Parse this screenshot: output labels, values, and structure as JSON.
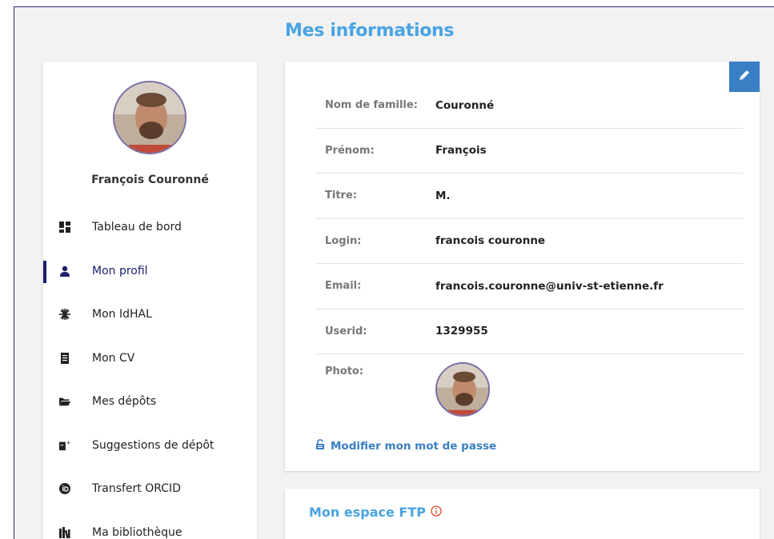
{
  "page": {
    "title": "Mes informations"
  },
  "sidebar": {
    "user_name": "François Couronné",
    "items": [
      {
        "label": "Tableau de bord",
        "icon": "dashboard-icon",
        "active": false
      },
      {
        "label": "Mon profil",
        "icon": "user-icon",
        "active": true
      },
      {
        "label": "Mon IdHAL",
        "icon": "idhal-icon",
        "active": false
      },
      {
        "label": "Mon CV",
        "icon": "cv-icon",
        "active": false
      },
      {
        "label": "Mes dépôts",
        "icon": "folder-icon",
        "active": false
      },
      {
        "label": "Suggestions de dépôt",
        "icon": "suggestion-icon",
        "active": false
      },
      {
        "label": "Transfert ORCID",
        "icon": "orcid-icon",
        "active": false
      },
      {
        "label": "Ma bibliothèque",
        "icon": "library-icon",
        "active": false
      }
    ]
  },
  "profile": {
    "fields": [
      {
        "label": "Nom de famille:",
        "value": "Couronné"
      },
      {
        "label": "Prénom:",
        "value": "François"
      },
      {
        "label": "Titre:",
        "value": "M."
      },
      {
        "label": "Login:",
        "value": "francois couronne"
      },
      {
        "label": "Email:",
        "value": "francois.couronne@univ-st-etienne.fr"
      },
      {
        "label": "Userid:",
        "value": "1329955"
      }
    ],
    "photo_label": "Photo:",
    "change_password": "Modifier mon mot de passe"
  },
  "ftp": {
    "title": "Mon espace FTP"
  },
  "colors": {
    "accent_blue": "#4aa3e3",
    "button_blue": "#3a7fc4",
    "active_nav": "#1c1f6b",
    "avatar_border": "#7b6ea6",
    "warning_red": "#e0482b"
  }
}
